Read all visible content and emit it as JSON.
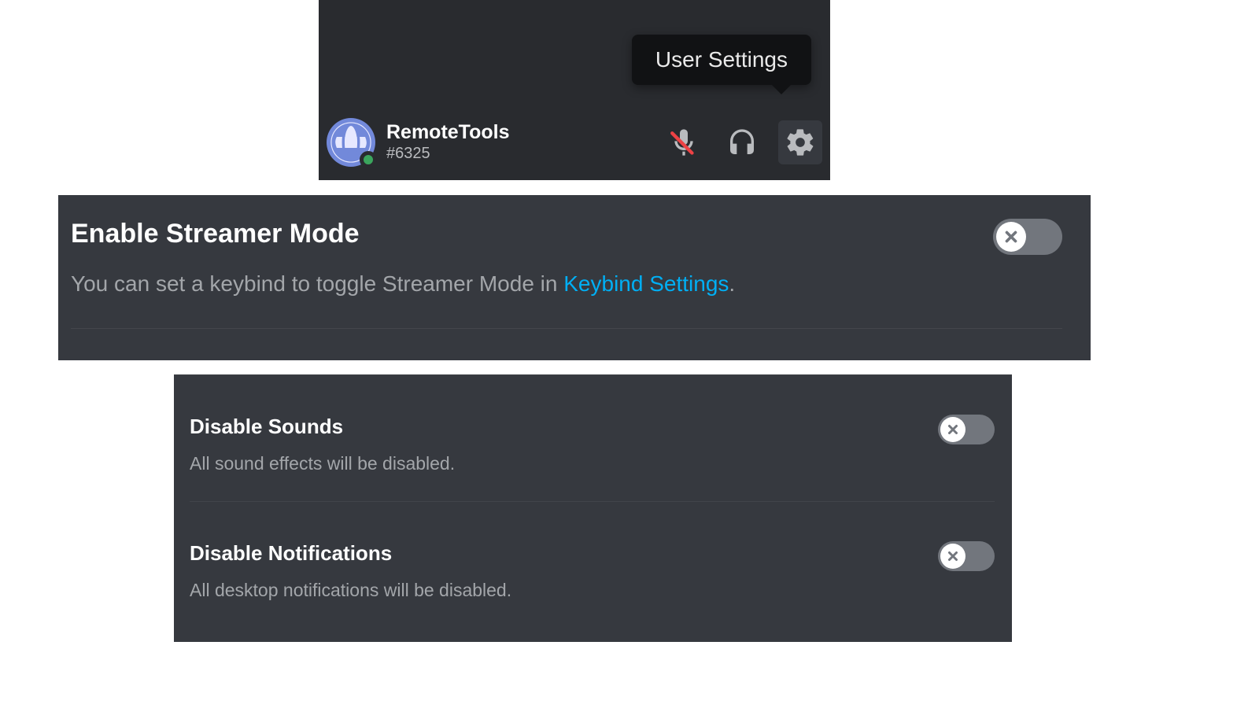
{
  "tooltip": {
    "label": "User Settings"
  },
  "user": {
    "name": "RemoteTools",
    "tag": "#6325",
    "status": "online"
  },
  "icons": {
    "mute": "microphone-muted-icon",
    "deafen": "headphones-icon",
    "settings": "gear-icon"
  },
  "settings": {
    "streamer_mode": {
      "title": "Enable Streamer Mode",
      "desc_prefix": "You can set a keybind to toggle Streamer Mode in ",
      "link_text": "Keybind Settings",
      "desc_suffix": ".",
      "enabled": false
    },
    "disable_sounds": {
      "title": "Disable Sounds",
      "desc": "All sound effects will be disabled.",
      "enabled": false
    },
    "disable_notifications": {
      "title": "Disable Notifications",
      "desc": "All desktop notifications will be disabled.",
      "enabled": false
    }
  },
  "colors": {
    "bg_panel": "#36393f",
    "bg_darker": "#292b2f",
    "link": "#00aff4",
    "toggle_off": "#72767d",
    "status_online": "#3ba55d"
  }
}
